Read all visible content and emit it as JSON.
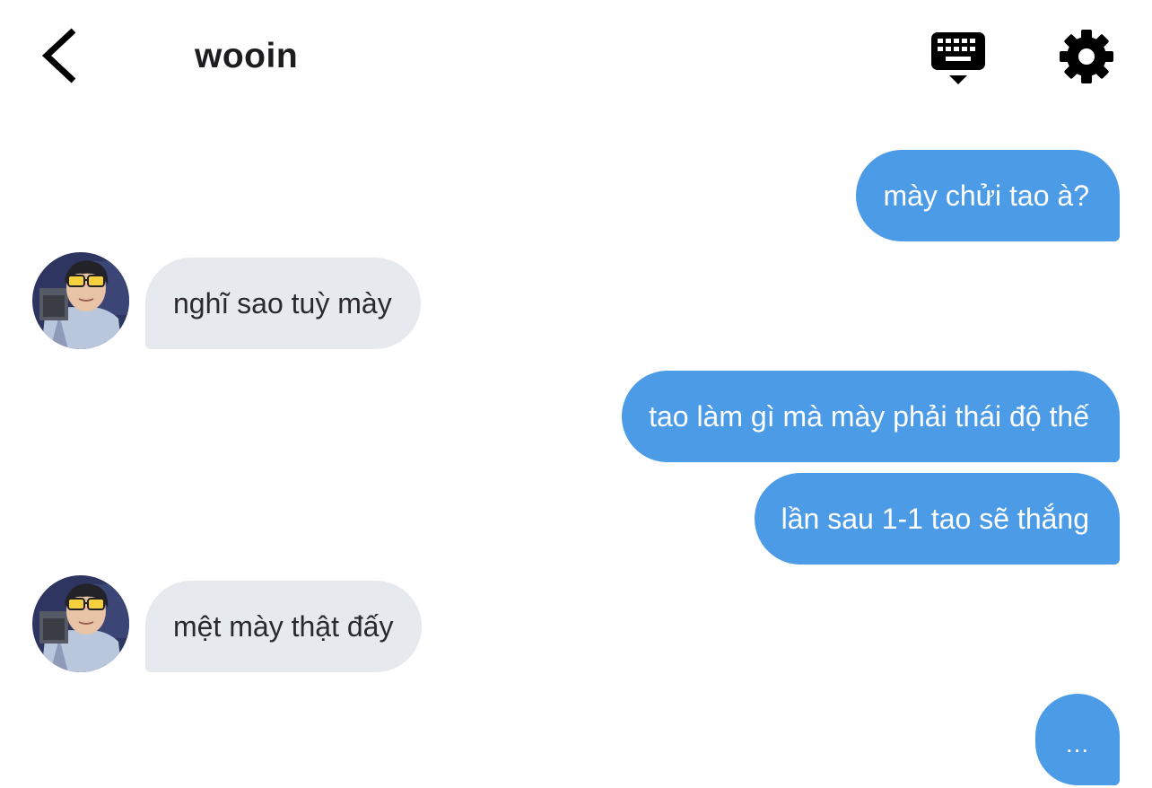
{
  "header": {
    "title": "wooin",
    "back_icon": "chevron-left-icon",
    "keyboard_icon": "keyboard-hide-icon",
    "settings_icon": "gear-icon"
  },
  "messages": [
    {
      "direction": "outgoing",
      "text": "mày chửi tao à?"
    },
    {
      "direction": "incoming",
      "text": "nghĩ sao tuỳ mày"
    },
    {
      "direction": "outgoing",
      "text": "tao làm gì mà mày phải thái độ thế"
    },
    {
      "direction": "outgoing",
      "text": "lần sau 1-1 tao sẽ thắng"
    },
    {
      "direction": "incoming",
      "text": "mệt mày thật đấy"
    }
  ],
  "typing_indicator": {
    "text": "..."
  },
  "colors": {
    "outgoing_bubble": "#4c9be6",
    "incoming_bubble": "#e6e9ee",
    "background": "#ffffff",
    "title": "#1d1d1f"
  }
}
